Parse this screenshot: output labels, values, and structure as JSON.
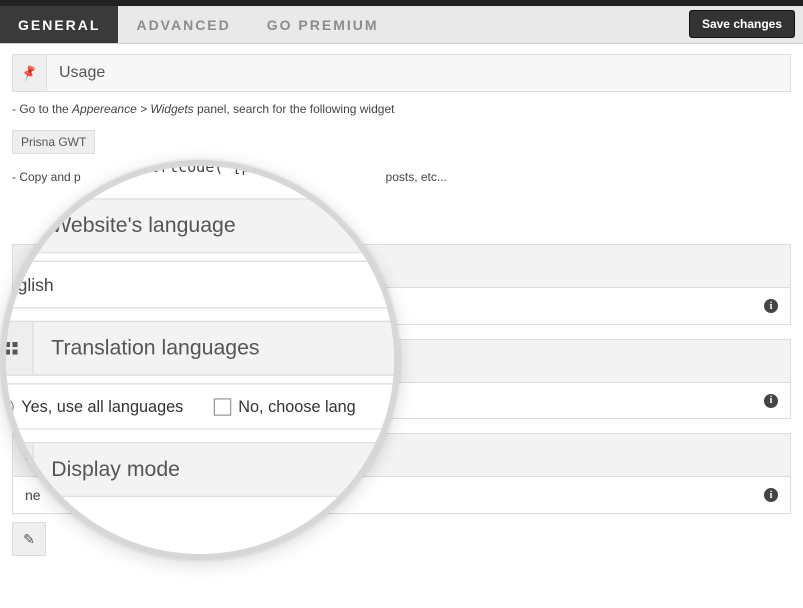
{
  "tabs": {
    "general": "General",
    "advanced": "Advanced",
    "premium": "Go Premium"
  },
  "buttons": {
    "save": "Save changes"
  },
  "usage": {
    "title": "Usage",
    "line1_a": "- Go to the ",
    "line1_b": "Appereance > Widgets",
    "line1_c": " panel, search for the following widget",
    "widget_chip": "Prisna GWT",
    "line2_visible": "- Copy and p",
    "line2_tail": "posts, etc...",
    "code_visible": "php echo do_shortcode('[prisna-g"
  },
  "fields": {
    "website_language": {
      "title": "Website's language",
      "value": "English"
    },
    "translation_languages": {
      "title": "Translation languages",
      "opt_yes": "Yes, use all languages",
      "opt_no": "No, choose lang"
    },
    "display_mode": {
      "title": "Display mode",
      "value_tail": "ne"
    }
  },
  "info_glyph": "i"
}
